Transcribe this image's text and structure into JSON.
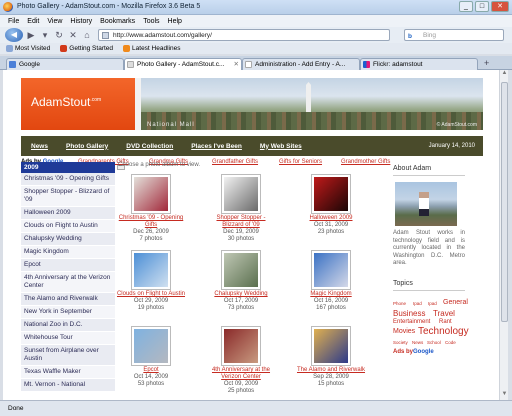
{
  "window": {
    "title": "Photo Gallery - AdamStout.com - Mozilla Firefox 3.6 Beta 5",
    "buttons": [
      "_",
      "□",
      "✕"
    ]
  },
  "menu": [
    "File",
    "Edit",
    "View",
    "History",
    "Bookmarks",
    "Tools",
    "Help"
  ],
  "nav": {
    "url": "http://www.adamstout.com/gallery/",
    "search_placeholder": "Bing"
  },
  "bookmarks": [
    "Most Visited",
    "Getting Started",
    "Latest Headlines"
  ],
  "tabs": [
    {
      "label": "Google",
      "color": "#4a7fd8"
    },
    {
      "label": "Photo Gallery - AdamStout.c...",
      "color": "#f0f0f0"
    },
    {
      "label": "Administration - Add Entry - A...",
      "color": "#ffffff"
    },
    {
      "label": "Flickr: adamstout",
      "color": "#e0187a"
    }
  ],
  "site": {
    "logo": "AdamStout",
    "logo_sup": ".com",
    "banner_caption": "National Mall",
    "banner_caption2": "© AdamStout.com",
    "nav": [
      "News",
      "Photo Gallery",
      "DVD Collection",
      "Places I've Been",
      "My Web Sites"
    ],
    "date": "January 14, 2010",
    "ads_label": "Ads by",
    "ads_brand": "Google",
    "ad_links": [
      "Grandparents Gifts",
      "Grandma Gifts",
      "Grandfather Gifts",
      "Gifts for Seniors",
      "Grandmother Gifts"
    ]
  },
  "sidebar": {
    "year": "2009",
    "items": [
      "Christmas '09 - Opening Gifts",
      "Shopper Stopper - Blizzard of '09",
      "Halloween 2009",
      "Clouds on Flight to Austin",
      "Chalupsky Wedding",
      "Magic Kingdom",
      "Epcot",
      "4th Anniversary at the Verizon Center",
      "The Alamo and Riverwalk",
      "New York in September",
      "National Zoo in D.C.",
      "Whitehouse Tour",
      "Sunset from Airplane over Austin",
      "Texas Waffle Maker",
      "Mt. Vernon - National"
    ]
  },
  "gallery": {
    "hint": "Choose a photo album to view.",
    "albums": [
      {
        "name": "Christmas '09 - Opening Gifts",
        "date": "Dec 26, 2009",
        "count": "7 photos",
        "c1": "#e3e0da",
        "c2": "#a2283a"
      },
      {
        "name": "Shopper Stopper - Blizzard of '09",
        "date": "Dec 19, 2009",
        "count": "30 photos",
        "c1": "#f2f2f2",
        "c2": "#6a6a6a"
      },
      {
        "name": "Halloween 2009",
        "date": "Oct 31, 2009",
        "count": "23 photos",
        "c1": "#c01a1a",
        "c2": "#1a0606"
      },
      {
        "name": "Clouds on Flight to Austin",
        "date": "Oct 29, 2009",
        "count": "19 photos",
        "c1": "#4c8fd6",
        "c2": "#d0e0f0"
      },
      {
        "name": "Chalupsky Wedding",
        "date": "Oct 17, 2009",
        "count": "73 photos",
        "c1": "#bfc7b4",
        "c2": "#5a6f4e"
      },
      {
        "name": "Magic Kingdom",
        "date": "Oct 16, 2009",
        "count": "167 photos",
        "c1": "#3b72c4",
        "c2": "#d4d8e8"
      },
      {
        "name": "Epcot",
        "date": "Oct 14, 2009",
        "count": "53 photos",
        "c1": "#7fb2e0",
        "c2": "#b4b8c0"
      },
      {
        "name": "4th Anniversary at the Verizon Center",
        "date": "Oct 09, 2009",
        "count": "25 photos",
        "c1": "#8a2a2a",
        "c2": "#c89a80"
      },
      {
        "name": "The Alamo and Riverwalk",
        "date": "Sep 28, 2009",
        "count": "15 photos",
        "c1": "#e0b050",
        "c2": "#2c3a8a"
      }
    ]
  },
  "about": {
    "heading": "About Adam",
    "text": "Adam Stout works in technology field and is currently located in the Washington D.C. Metro area.",
    "topics_heading": "Topics",
    "tags": [
      "Phone",
      "Ipad",
      "Ipad",
      "General",
      "Business",
      "Travel",
      "Entertainment",
      "Rant",
      "Movies",
      "Technology",
      "Society",
      "News",
      "School",
      "Code"
    ],
    "ads_label": "Ads by",
    "ads_brand": "Google"
  },
  "status": "Done"
}
